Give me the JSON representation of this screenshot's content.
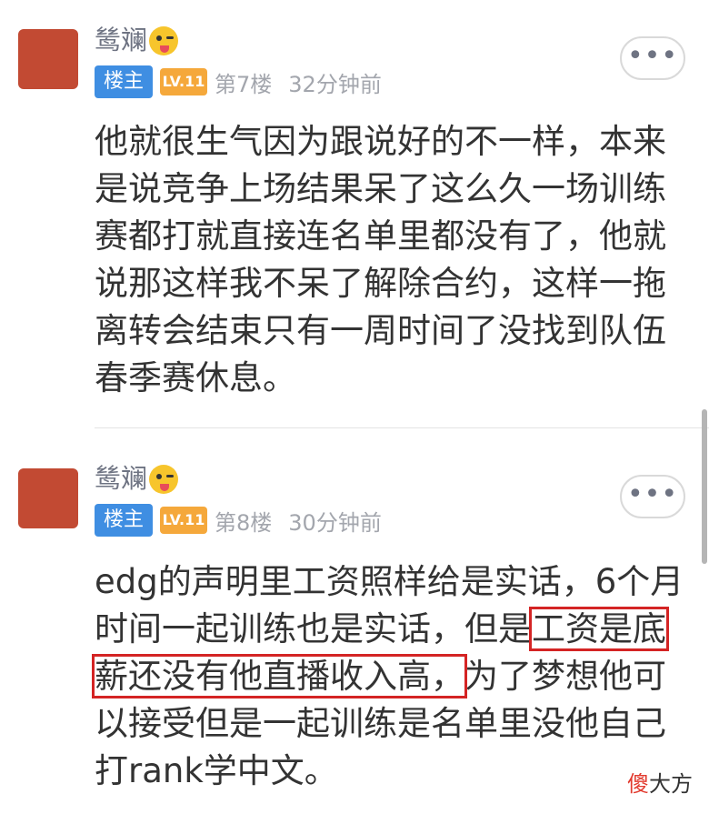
{
  "posts": [
    {
      "username": "鸶斓",
      "owner_badge": "楼主",
      "level_badge": "LV.11",
      "floor": "第7楼",
      "time": "32分钟前",
      "more_label": "•••",
      "content_lines": [
        "他就很生气因为跟说好的不一样，本来",
        "是说竞争上场结果呆了这么久一场训练",
        "赛都打就直接连名单里都没有了，他就",
        "说那这样我不呆了解除合约，这样一拖",
        "离转会结束只有一周时间了没找到队伍",
        "春季赛休息。"
      ]
    },
    {
      "username": "鸶斓",
      "owner_badge": "楼主",
      "level_badge": "LV.11",
      "floor": "第8楼",
      "time": "30分钟前",
      "more_label": "•••",
      "content": {
        "line1": "edg的声明里工资照样给是实话，6个月",
        "line2_a": "时间一起训练也是实话，但是",
        "line2_hl": "工资是底",
        "line3_hl": "薪还没有他直播收入高，",
        "line3_b": "为了梦想他可",
        "line4": "以接受但是一起训练是名单里没他自己",
        "line5": "打rank学中文。"
      }
    }
  ],
  "watermark": {
    "mark": "傻",
    "text": "大方"
  }
}
